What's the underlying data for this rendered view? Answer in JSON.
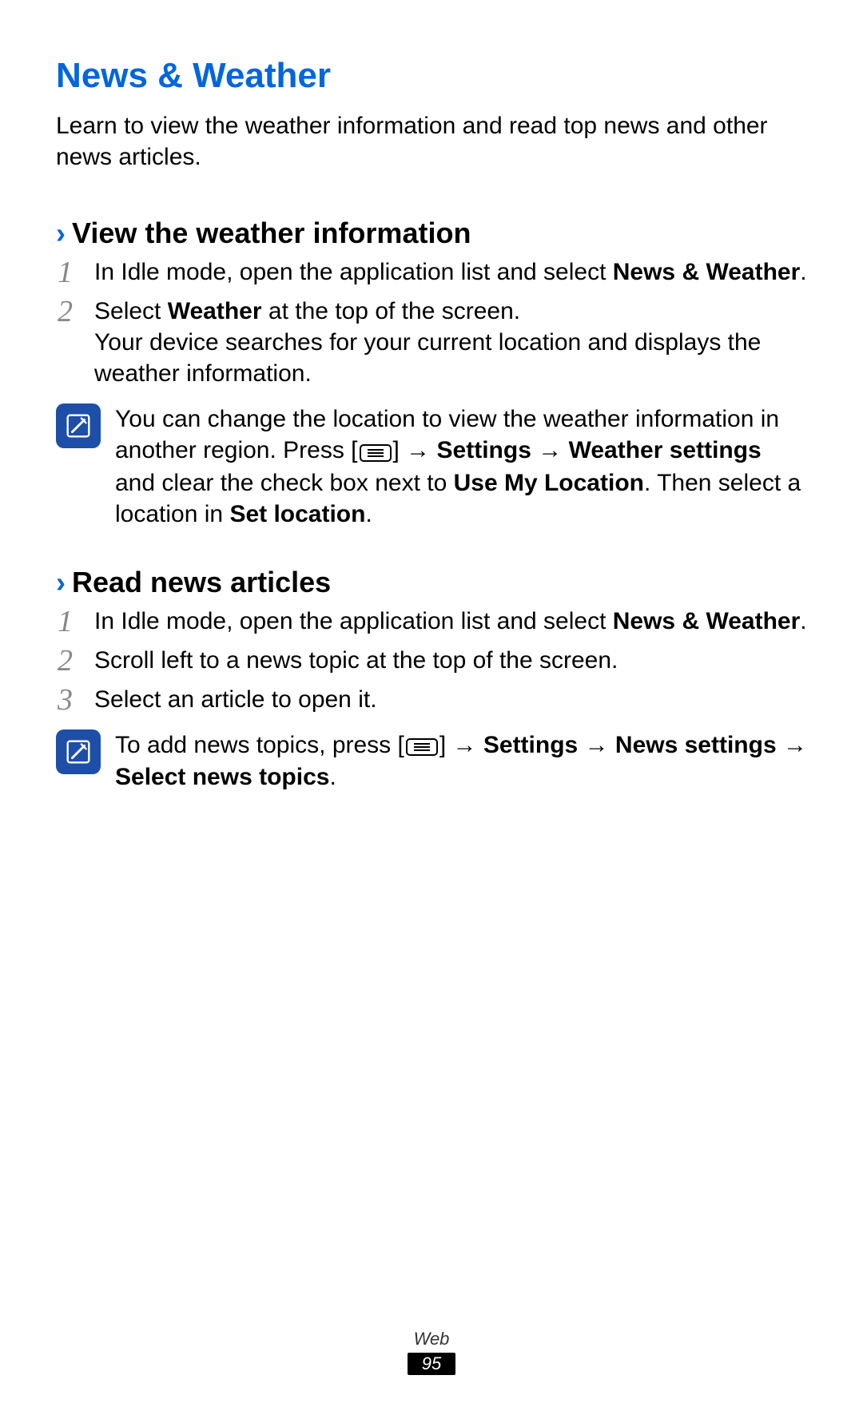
{
  "title": "News & Weather",
  "intro": "Learn to view the weather information and read top news and other news articles.",
  "section1": {
    "heading": "View the weather information",
    "step1_pre": "In Idle mode, open the application list and select ",
    "step1_bold": "News & Weather",
    "step1_end": ".",
    "step2_pre": "Select ",
    "step2_bold": "Weather",
    "step2_post": " at the top of the screen.",
    "step2_extra": "Your device searches for your current location and displays the weather information.",
    "note_pre": "You can change the location to view the weather information in another region. Press [",
    "note_post1": "] → ",
    "note_b1": "Settings",
    "note_arrow1": " → ",
    "note_b2": "Weather settings",
    "note_mid": " and clear the check box next to ",
    "note_b3": "Use My Location",
    "note_mid2": ". Then select a location in ",
    "note_b4": "Set location",
    "note_end": "."
  },
  "section2": {
    "heading": "Read news articles",
    "step1_pre": "In Idle mode, open the application list and select ",
    "step1_bold": "News & Weather",
    "step1_end": ".",
    "step2": "Scroll left to a news topic at the top of the screen.",
    "step3": "Select an article to open it.",
    "note_pre": "To add news topics, press [",
    "note_post1": "] → ",
    "note_b1": "Settings",
    "note_arrow1": " → ",
    "note_b2": "News settings",
    "note_arrow2": " → ",
    "note_b3": "Select news topics",
    "note_end": "."
  },
  "footer": {
    "section": "Web",
    "page": "95"
  }
}
